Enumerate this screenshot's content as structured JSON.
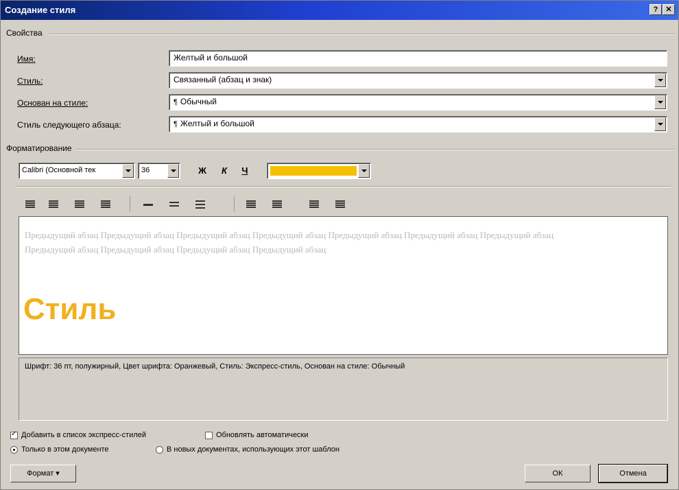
{
  "window": {
    "title": "Создание стиля",
    "help_btn": "?",
    "close_btn": "✕"
  },
  "properties": {
    "group_label": "Свойства",
    "name_label": "Имя:",
    "name_value": "Желтый и большой",
    "style_type_label": "Стиль:",
    "style_type_value": "Связанный (абзац и знак)",
    "based_on_label": "Основан на стиле:",
    "based_on_value": "Обычный",
    "next_para_label": "Стиль следующего абзаца:",
    "next_para_value": "Желтый и большой"
  },
  "formatting": {
    "group_label": "Форматирование",
    "font_name": "Calibri (Основной тек",
    "font_size": "36",
    "bold": "Ж",
    "italic": "К",
    "underline": "Ч",
    "font_color": "#f5c000"
  },
  "preview": {
    "previous_paragraph": "Предыдущий абзац Предыдущий абзац Предыдущий абзац Предыдущий абзац Предыдущий абзац Предыдущий абзац Предыдущий абзац Предыдущий абзац Предыдущий абзац Предыдущий абзац Предыдущий абзац",
    "sample_text": "Стиль",
    "sample_color": "#f2b01e"
  },
  "description": "Шрифт: 36 пт, полужирный, Цвет шрифта: Оранжевый, Стиль: Экспресс-стиль, Основан на стиле: Обычный",
  "options": {
    "add_to_quick": "Добавить в список экспресс-стилей",
    "auto_update": "Обновлять автоматически",
    "only_this_doc": "Только в этом документе",
    "new_docs": "В новых документах, использующих этот шаблон"
  },
  "buttons": {
    "format": "Формат ▾",
    "ok": "ОК",
    "cancel": "Отмена"
  }
}
